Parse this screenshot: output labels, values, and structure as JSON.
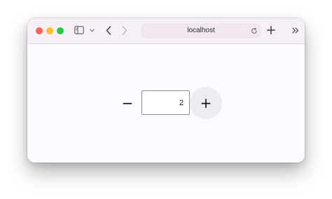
{
  "browser": {
    "address": "localhost",
    "icons": {
      "sidebar": "sidebar-icon",
      "sidebar_menu": "chevron-down-icon",
      "back": "chevron-left-icon",
      "forward": "chevron-right-icon",
      "reload": "reload-icon",
      "new_tab": "plus-icon",
      "overflow": "double-chevron-right-icon"
    },
    "traffic_lights": [
      "#fe5f57",
      "#febc2e",
      "#28c840"
    ]
  },
  "stepper": {
    "decrement_label": "−",
    "increment_label": "+",
    "value": "2"
  }
}
